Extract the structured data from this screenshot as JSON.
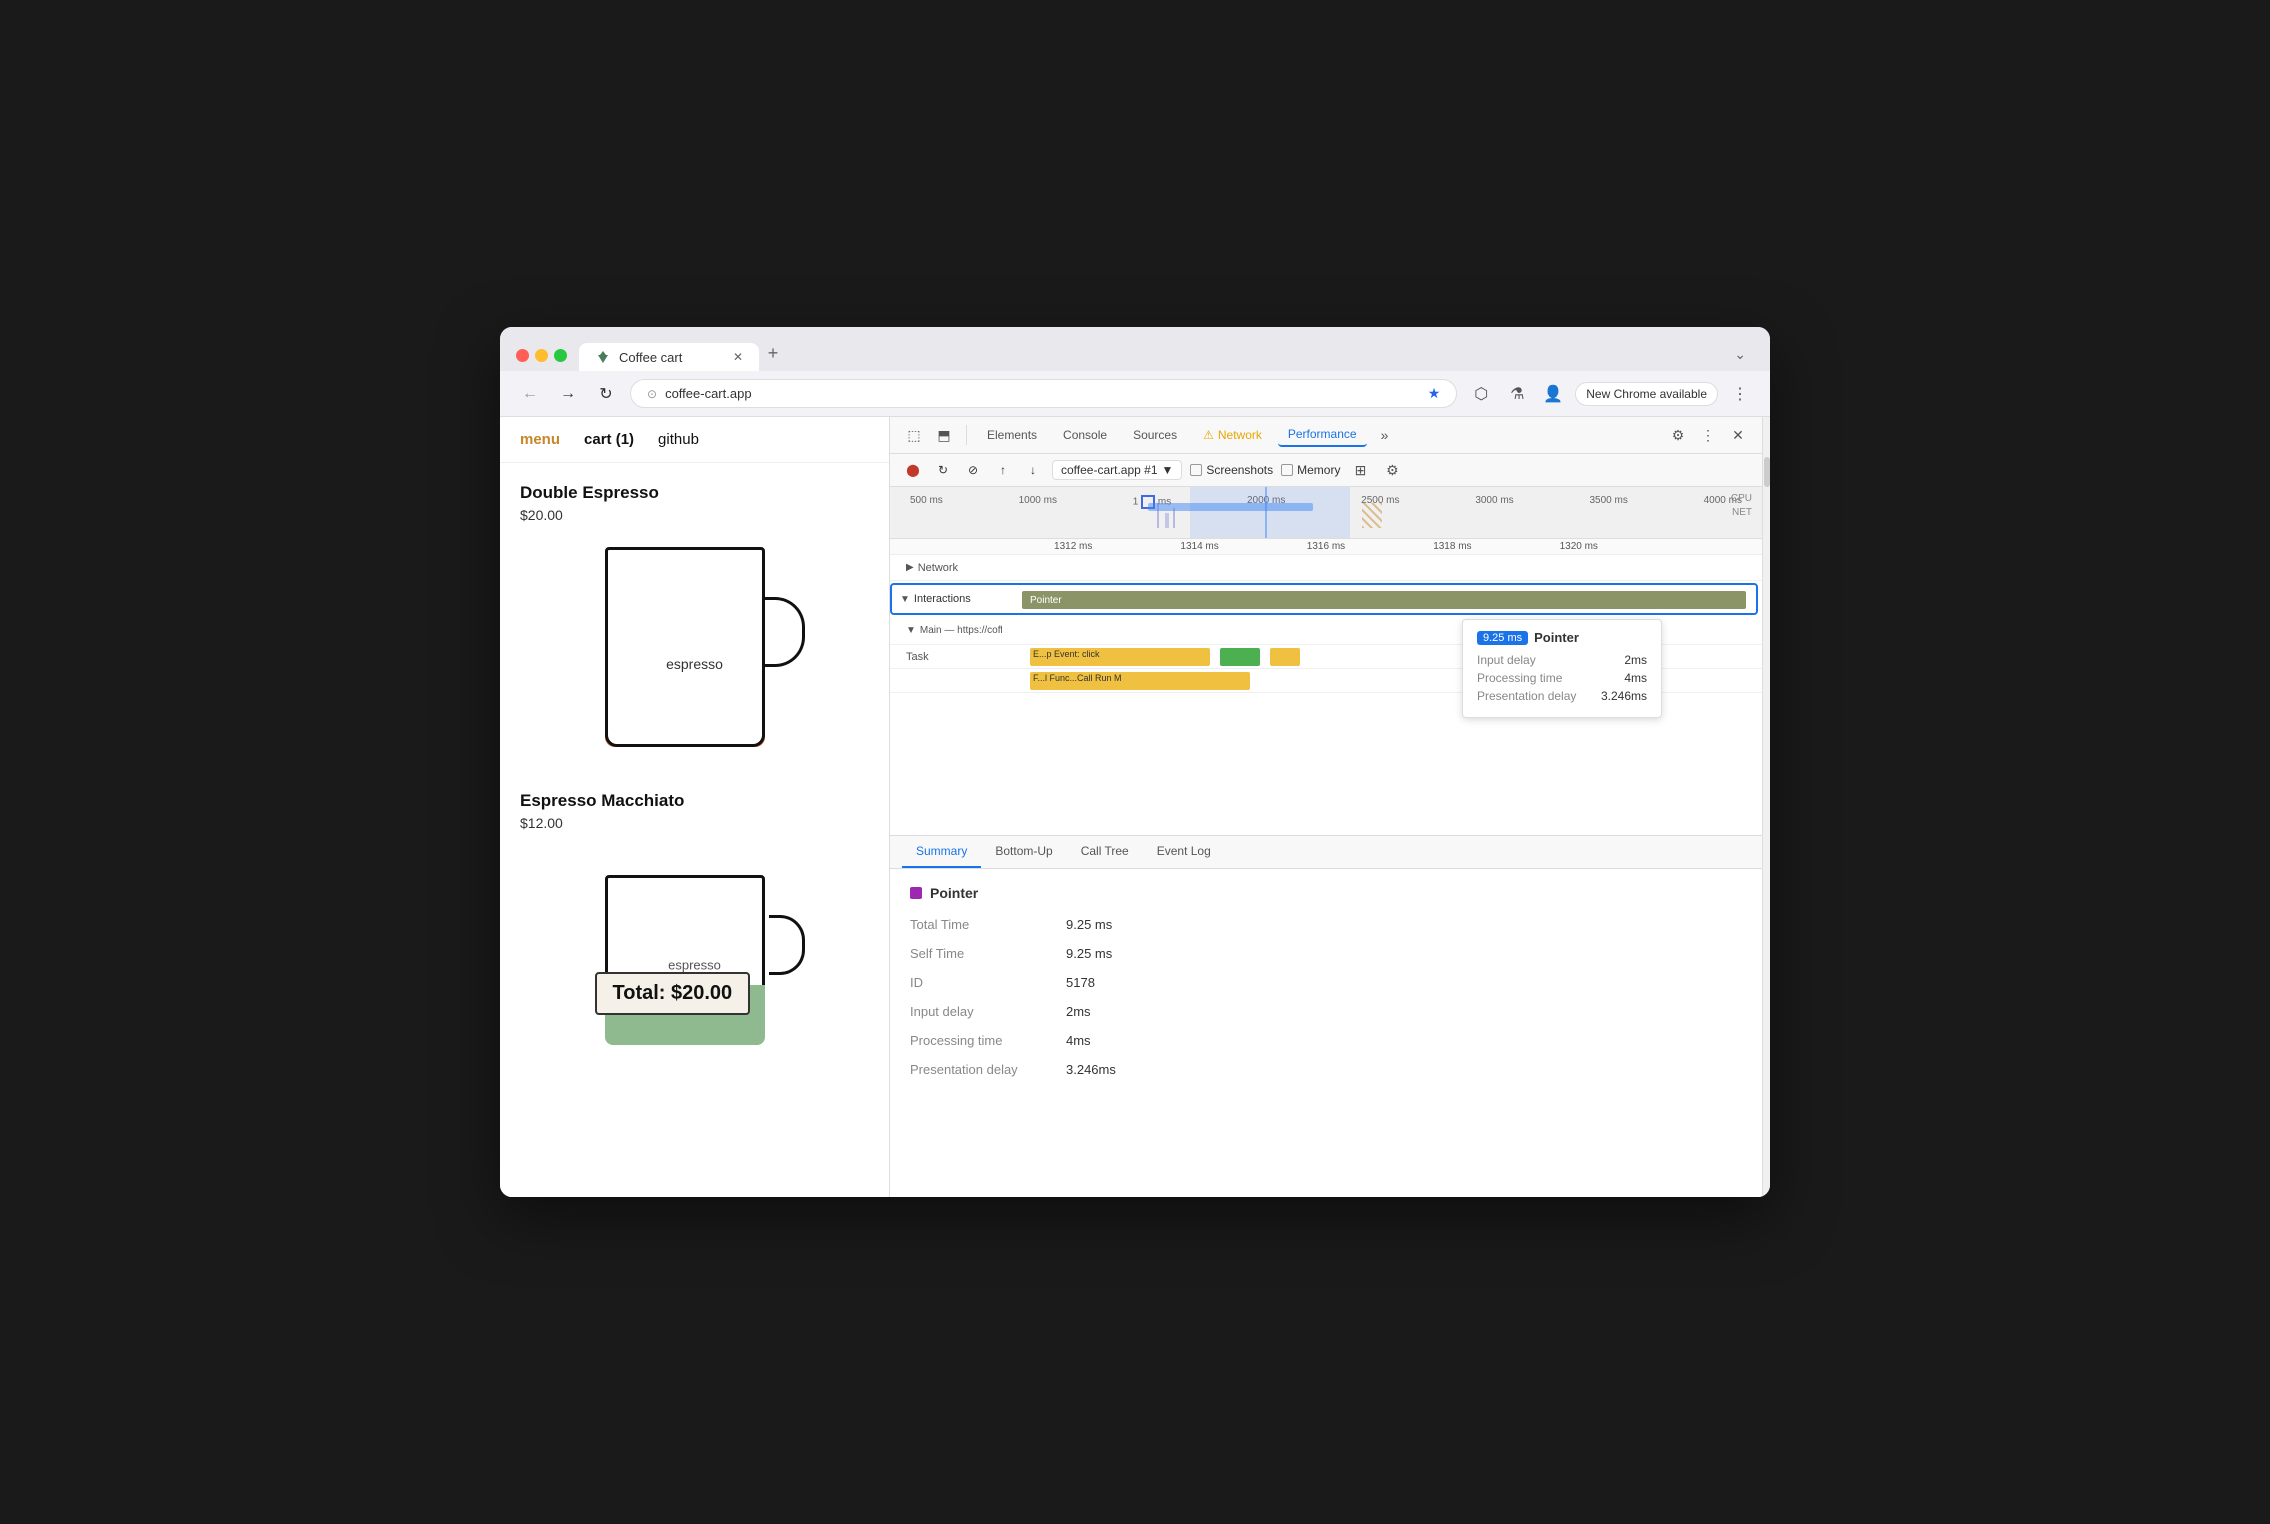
{
  "browser": {
    "tab_title": "Coffee cart",
    "tab_favicon": "🌿",
    "address": "coffee-cart.app",
    "new_chrome_label": "New Chrome available"
  },
  "website": {
    "nav": {
      "menu": "menu",
      "cart": "cart (1)",
      "github": "github"
    },
    "product1": {
      "name": "Double Espresso",
      "price": "$20.00",
      "label": "espresso"
    },
    "product2": {
      "name": "Espresso Macchiato",
      "price": "$12.00",
      "label": "espresso"
    },
    "total": "Total: $20.00"
  },
  "devtools": {
    "tabs": [
      "Elements",
      "Console",
      "Sources",
      "Network",
      "Performance"
    ],
    "active_tab": "Performance",
    "instance": "coffee-cart.app #1",
    "screenshots_label": "Screenshots",
    "memory_label": "Memory",
    "timeline": {
      "ruler_ticks": [
        "500 ms",
        "1000 ms",
        "1 ms",
        "2000 ms",
        "2500 ms",
        "3000 ms",
        "3500 ms",
        "4000 ms"
      ],
      "sub_ticks": [
        "1312 ms",
        "1314 ms",
        "1316 ms",
        "1318 ms",
        "1320 ms"
      ],
      "rows": {
        "network_label": "Network",
        "interactions_label": "Interactions",
        "main_label": "Main — https://coffee-cart.app/",
        "task_label": "Task",
        "event_label": "E...p",
        "event_name": "Event: click",
        "func_label": "F...l",
        "func_name": "Func...Call  Run M"
      }
    },
    "tooltip": {
      "time": "9.25 ms",
      "name": "Pointer",
      "input_delay_label": "Input delay",
      "input_delay_val": "2ms",
      "processing_time_label": "Processing time",
      "processing_time_val": "4ms",
      "presentation_delay_label": "Presentation delay",
      "presentation_delay_val": "3.246ms"
    },
    "bottom_tabs": [
      "Summary",
      "Bottom-Up",
      "Call Tree",
      "Event Log"
    ],
    "active_bottom_tab": "Summary",
    "summary": {
      "title": "Pointer",
      "total_time_label": "Total Time",
      "total_time_val": "9.25 ms",
      "self_time_label": "Self Time",
      "self_time_val": "9.25 ms",
      "id_label": "ID",
      "id_val": "5178",
      "input_delay_label": "Input delay",
      "input_delay_val": "2ms",
      "processing_time_label": "Processing time",
      "processing_time_val": "4ms",
      "presentation_delay_label": "Presentation delay",
      "presentation_delay_val": "3.246ms"
    }
  }
}
